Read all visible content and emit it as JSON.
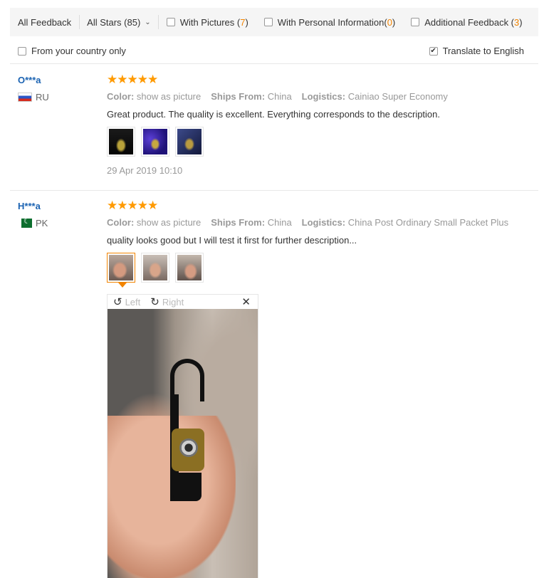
{
  "filters": {
    "all_feedback": "All Feedback",
    "all_stars": "All Stars (85)",
    "with_pictures_label": "With Pictures (",
    "with_pictures_count": "7",
    "personal_info_label": "With Personal Information(",
    "personal_info_count": "0",
    "additional_label": "Additional Feedback (",
    "additional_count": "3",
    "close_paren": ")",
    "from_country": "From your country only",
    "translate": "Translate to English",
    "translate_checked": true,
    "count_color": "#f28400"
  },
  "reviews": [
    {
      "user": "O***a",
      "country": "RU",
      "stars": "★★★★★",
      "rating": 5,
      "color_label": "Color:",
      "color_value": "show as picture",
      "ships_label": "Ships From:",
      "ships_value": "China",
      "logistics_label": "Logistics:",
      "logistics_value": "Cainiao Super Economy",
      "text": "Great product. The quality is excellent. Everything corresponds to the description.",
      "date": "29 Apr 2019 10:10"
    },
    {
      "user": "H***a",
      "country": "PK",
      "stars": "★★★★★",
      "rating": 5,
      "color_label": "Color:",
      "color_value": "show as picture",
      "ships_label": "Ships From:",
      "ships_value": "China",
      "logistics_label": "Logistics:",
      "logistics_value": "China Post Ordinary Small Packet Plus",
      "text": "quality looks good but I will test it first for further description..."
    }
  ],
  "viewer": {
    "left": "Left",
    "right": "Right"
  },
  "colors": {
    "link_blue": "#1b63b2",
    "star_orange": "#ff9a00",
    "accent_orange": "#f28400"
  }
}
